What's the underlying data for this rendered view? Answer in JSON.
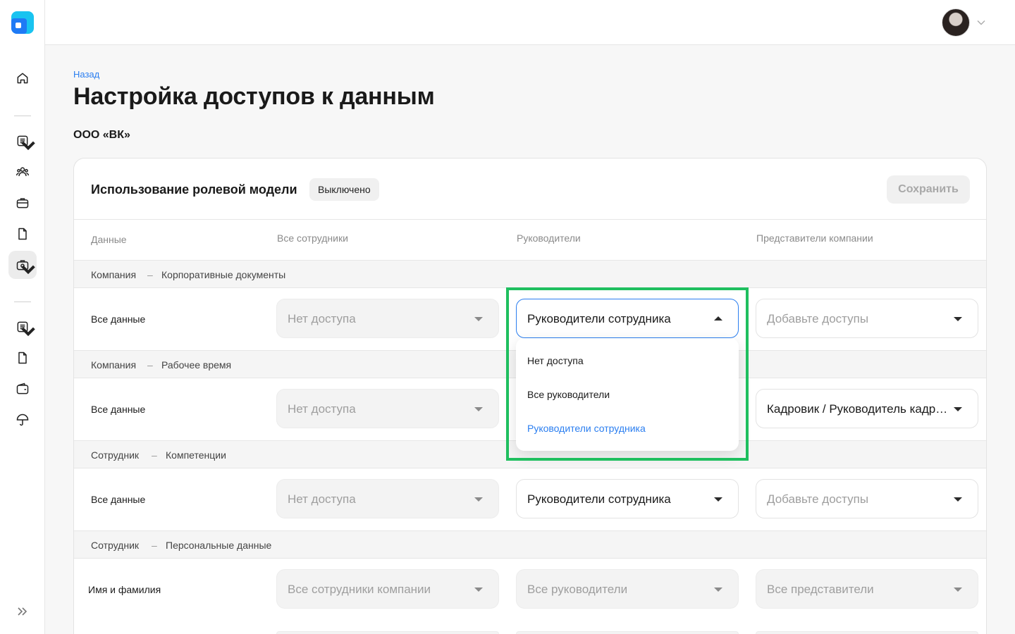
{
  "header": {
    "back_label": "Назад",
    "title": "Настройка доступов к данным",
    "company": "ООО «ВК»"
  },
  "card": {
    "title": "Использование ролевой модели",
    "status": "Выключено",
    "save_label": "Сохранить"
  },
  "columns": [
    "Данные",
    "Все сотрудники",
    "Руководители",
    "Представители компании"
  ],
  "sections": [
    {
      "left": "Компания",
      "dash": "–",
      "right": "Корпоративные документы",
      "label": "Все данные",
      "selects": [
        "Нет доступа",
        "Руководители сотрудника",
        "Добавьте доступы"
      ]
    },
    {
      "left": "Компания",
      "dash": "–",
      "right": "Рабочее время",
      "label": "Все данные",
      "selects": [
        "Нет доступа",
        "",
        "Кадровик / Руководитель кадровой службы"
      ]
    },
    {
      "left": "Сотрудник",
      "dash": "–",
      "right": "Компетенции",
      "label": "Все данные",
      "selects": [
        "Нет доступа",
        "Руководители сотрудника",
        "Добавьте доступы"
      ]
    },
    {
      "left": "Сотрудник",
      "dash": "–",
      "right": "Персональные данные",
      "label": "Имя и фамилия",
      "selects": [
        "Все сотрудники компании",
        "Все руководители",
        "Все представители"
      ]
    }
  ],
  "dropdown": {
    "options": [
      "Нет доступа",
      "Все руководители",
      "Руководители сотрудника"
    ],
    "selected": "Руководители сотрудника"
  },
  "colors": {
    "accent": "#2a7ef0",
    "highlight": "#1fbf5f"
  },
  "icons": [
    "home-icon",
    "document-list-icon",
    "users-icon",
    "briefcase-icon",
    "file-icon",
    "case-settings-icon",
    "wallet-icon",
    "umbrella-icon",
    "expand-icon"
  ]
}
